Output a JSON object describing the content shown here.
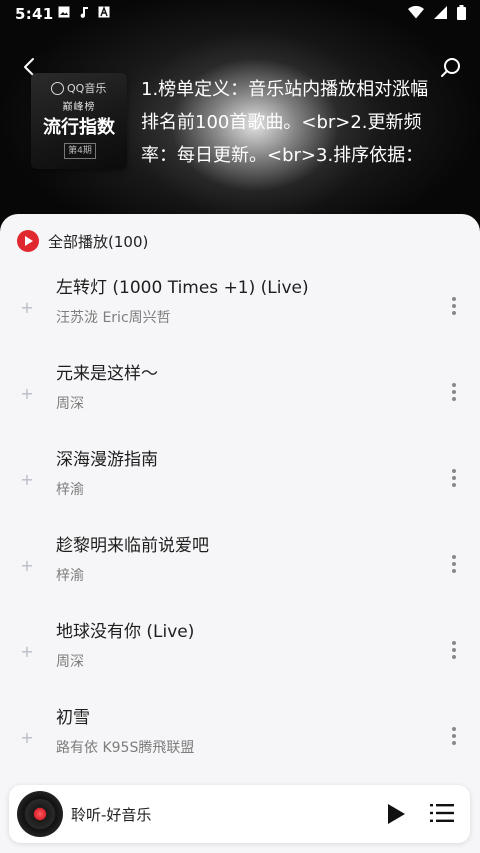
{
  "status_bar": {
    "time": "5:41",
    "left_icons": [
      "image-icon",
      "music-note-icon",
      "a-box-icon"
    ],
    "right_icons": [
      "wifi-icon",
      "cellular-icon",
      "battery-icon"
    ]
  },
  "header": {
    "back_icon": "chevron-left-icon",
    "search_icon": "search-icon",
    "cover": {
      "logo_text": "QQ音乐",
      "sub_text": "巅峰榜",
      "title": "流行指数",
      "badge": "第4期"
    },
    "description": "1.榜单定义：音乐站内播放相对涨幅排名前100首歌曲。<br>2.更新频率：每日更新。<br>3.排序依据："
  },
  "list": {
    "play_all_label": "全部播放(100)",
    "accent_color": "#e0282f",
    "songs": [
      {
        "title": "左转灯 (1000 Times +1) (Live)",
        "artist": "汪苏泷 Eric周兴哲"
      },
      {
        "title": "元来是这样～",
        "artist": "周深"
      },
      {
        "title": "深海漫游指南",
        "artist": "梓渝"
      },
      {
        "title": "趁黎明来临前说爱吧",
        "artist": "梓渝"
      },
      {
        "title": "地球没有你 (Live)",
        "artist": "周深"
      },
      {
        "title": "初雪",
        "artist": "路有依 K95S腾飛联盟"
      }
    ]
  },
  "mini_player": {
    "title": "聆听-好音乐",
    "play_icon": "play-icon",
    "playlist_icon": "playlist-icon"
  }
}
